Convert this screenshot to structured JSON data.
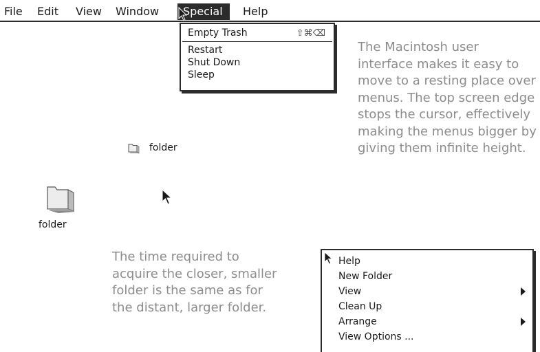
{
  "menubar": {
    "items": [
      {
        "label": "File"
      },
      {
        "label": "Edit"
      },
      {
        "label": "View"
      },
      {
        "label": "Window"
      },
      {
        "label": "Special"
      },
      {
        "label": "Help"
      }
    ]
  },
  "special_menu": {
    "items": [
      {
        "label": "Empty Trash",
        "shortcut": "⇧⌘⌫"
      },
      {
        "label": "Restart"
      },
      {
        "label": "Shut Down"
      },
      {
        "label": "Sleep"
      }
    ]
  },
  "captions": {
    "top_right": [
      "The Macintosh user",
      "interface makes it easy to",
      "move to a resting place over",
      "menus. The top screen edge",
      "stops the cursor, effectively",
      "making the menus bigger by",
      "giving them infinite height."
    ],
    "bottom_left": [
      "The time required to",
      "acquire the closer, smaller",
      "folder is the same as for",
      "the distant, larger folder."
    ]
  },
  "icons": {
    "small_folder_label": "folder",
    "large_folder_label": "folder"
  },
  "context_menu": {
    "items": [
      {
        "label": "Help"
      },
      {
        "label": "New Folder"
      },
      {
        "label": "View",
        "submenu": true
      },
      {
        "label": "Clean Up"
      },
      {
        "label": "Arrange",
        "submenu": true
      },
      {
        "label": "View Options ..."
      }
    ]
  },
  "colors": {
    "menu_highlight": "#2b2b2b",
    "caption_text": "#8c8c8c"
  }
}
